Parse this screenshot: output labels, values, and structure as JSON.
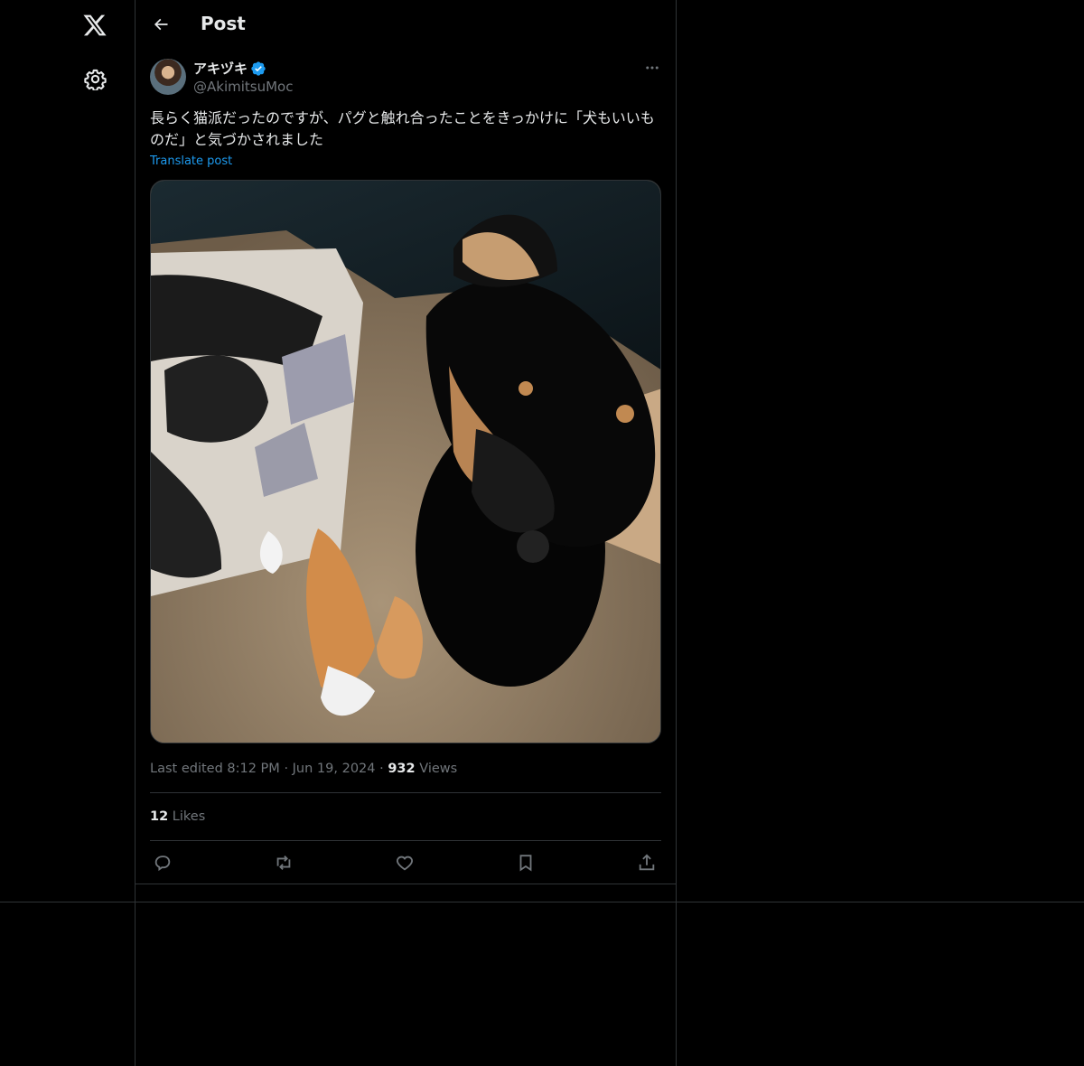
{
  "header": {
    "title": "Post"
  },
  "nav": {
    "logo": "x-logo-icon",
    "settings": "gear-icon"
  },
  "post": {
    "author": {
      "display_name": "アキヅキ",
      "handle": "@AkimitsuMoc",
      "verified": true
    },
    "text": "長らく猫派だったのですが、パグと触れ合ったことをきっかけに「犬もいいものだ」と気づかされました",
    "translate_label": "Translate post",
    "media_alt": "Black and tan puppy stepping forward beside a patterned blanket",
    "meta": {
      "edited_prefix": "Last edited",
      "time": "8:12 PM",
      "date": "Jun 19, 2024",
      "separator": "·",
      "views_count": "932",
      "views_label": "Views"
    },
    "likes": {
      "count": "12",
      "label": "Likes"
    },
    "actions": [
      "reply-icon",
      "repost-icon",
      "like-icon",
      "bookmark-icon",
      "share-icon"
    ]
  },
  "colors": {
    "background": "#000000",
    "text": "#e7e9ea",
    "muted": "#71767b",
    "accent": "#1d9bf0",
    "border": "#2f3336"
  }
}
